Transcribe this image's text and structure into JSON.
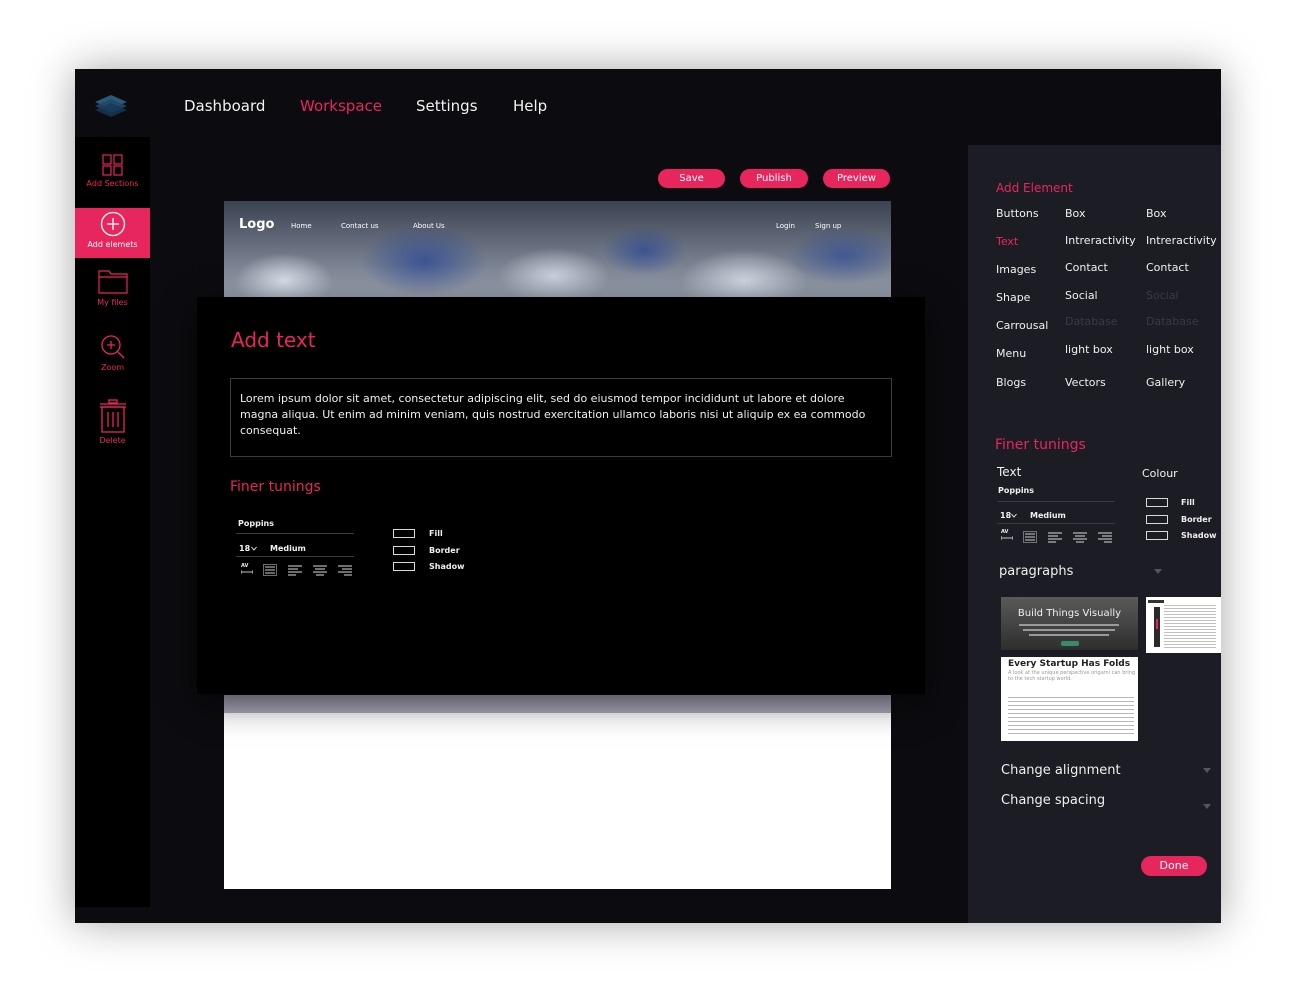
{
  "nav": {
    "items": [
      {
        "label": "Dashboard",
        "active": false
      },
      {
        "label": "Workspace",
        "active": true
      },
      {
        "label": "Settings",
        "active": false
      },
      {
        "label": "Help",
        "active": false
      }
    ]
  },
  "rail": {
    "items": [
      {
        "label": "Add Sections",
        "icon": "grid-icon"
      },
      {
        "label": "Add elemets",
        "icon": "plus-circle-icon",
        "active": true
      },
      {
        "label": "My files",
        "icon": "folder-icon"
      },
      {
        "label": "Zoom",
        "icon": "zoom-in-icon"
      },
      {
        "label": "Delete",
        "icon": "trash-icon"
      }
    ]
  },
  "toolbar": {
    "save_label": "Save",
    "publish_label": "Publish",
    "preview_label": "Preview"
  },
  "hero": {
    "logo": "Logo",
    "links": [
      "Home",
      "Contact us",
      "About Us"
    ],
    "login": "Login",
    "signup": "Sign up"
  },
  "modal": {
    "title": "Add text",
    "body": "Lorem ipsum dolor sit amet, consectetur adipiscing elit, sed do eiusmod tempor incididunt ut labore et dolore magna aliqua. Ut enim ad minim veniam, quis nostrud exercitation ullamco laboris nisi ut aliquip ex ea commodo consequat.",
    "finer_title": "Finer tunings",
    "font": "Poppins",
    "size": "18",
    "weight": "Medium",
    "av": "AV",
    "fill": "Fill",
    "border": "Border",
    "shadow": "Shadow"
  },
  "panel": {
    "add_element_title": "Add Element",
    "col1": [
      "Buttons",
      "Text",
      "Images",
      "Shape",
      "Carrousal",
      "Menu",
      "Blogs"
    ],
    "col2": [
      "Box",
      "Intreractivity",
      "Contact",
      "Social",
      "Database",
      "light box",
      "Vectors"
    ],
    "col3": [
      "Box",
      "Intreractivity",
      "Contact",
      "Social",
      "Database",
      "light box",
      "Gallery"
    ],
    "finer_title": "Finer tunings",
    "text_label": "Text",
    "colour_label": "Colour",
    "font": "Poppins",
    "size": "18",
    "weight": "Medium",
    "av": "AV",
    "fill": "Fill",
    "border": "Border",
    "shadow": "Shadow",
    "paragraphs_label": "paragraphs",
    "thumb1_title": "Build Things Visually",
    "thumb3_title": "Every Startup Has Folds",
    "thumb3_sub": "A look at the unique perspective origami can bring to the tech startup world.",
    "alignment_label": "Change alignment",
    "spacing_label": "Change spacing",
    "done_label": "Done"
  },
  "colors": {
    "accent": "#e8265e",
    "background": "#0c0c10",
    "panel": "#1c1c24"
  }
}
